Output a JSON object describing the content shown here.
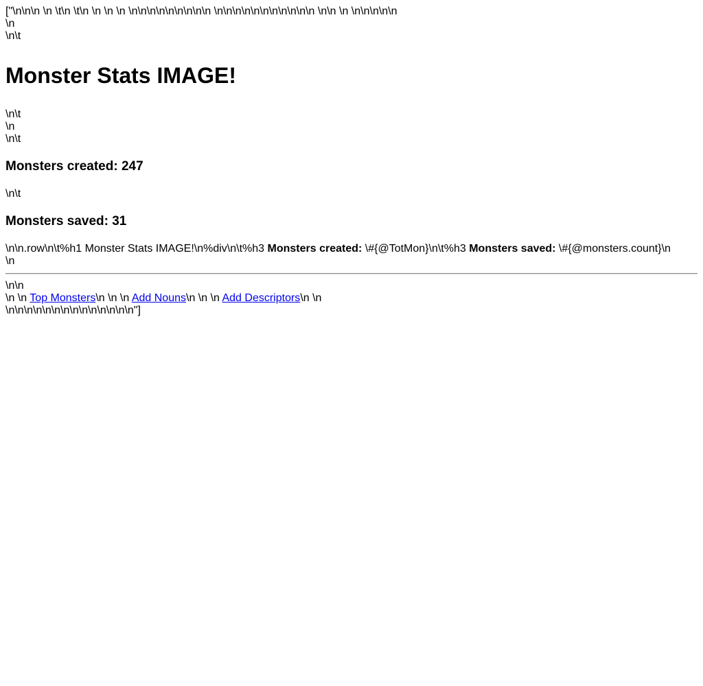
{
  "raw": {
    "line1": "[\"\\n\\n\\n \\n \\t\\n \\t\\n \\n \\n \\n \\n\\n\\n\\n\\n\\n\\n\\n\\n \\n\\n\\n\\n\\n\\n\\n\\n\\n\\n\\n \\n\\n \\n \\n\\n\\n\\n\\n",
    "line2": "\\n",
    "line3": "\\n\\t",
    "line4": "\\n\\t",
    "line5": "\\n",
    "line6": "\\n\\t",
    "line7": "\\n\\t",
    "line8": "\\n",
    "line9": "\\n\\n",
    "line_links_prefix": "\\n \\n ",
    "line_links_sep1": "\\n \\n \\n ",
    "line_links_sep2": "\\n \\n \\n ",
    "line_links_suffix": "\\n \\n",
    "line_end": "\\n\\n\\n\\n\\n\\n\\n\\n\\n\\n\\n\\n\\n\\n\"]"
  },
  "header": {
    "title": "Monster Stats IMAGE!"
  },
  "stats": {
    "created_label": "Monsters created: 247",
    "saved_label": "Monsters saved: 31"
  },
  "template_source": {
    "prefix": "\\n\\n.row\\n\\t%h1 Monster Stats IMAGE!\\n%div\\n\\t%h3 ",
    "created_bold": "Monsters created:",
    "created_expr": " \\#{@TotMon}\\n\\t%h3 ",
    "saved_bold": "Monsters saved:",
    "saved_expr": " \\#{@monsters.count}\\n"
  },
  "links": {
    "top_monsters": "Top Monsters",
    "add_nouns": "Add Nouns",
    "add_descriptors": "Add Descriptors"
  }
}
